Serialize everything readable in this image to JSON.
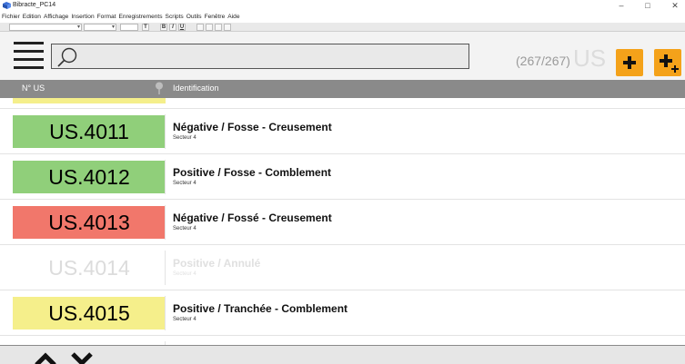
{
  "window": {
    "title": "Bibracte_PC14",
    "controls": [
      "–",
      "□",
      "✕"
    ]
  },
  "menu": [
    "Fichier",
    "Edition",
    "Affichage",
    "Insertion",
    "Format",
    "Enregistrements",
    "Scripts",
    "Outils",
    "Fenêtre",
    "Aide"
  ],
  "format_toolbar": {
    "buttons": [
      "T",
      "B",
      "I",
      "U"
    ]
  },
  "search": {
    "value": "",
    "placeholder": ""
  },
  "counter": {
    "text": "(267/267)",
    "unit": "US"
  },
  "columns": {
    "us": "N° US",
    "identification": "Identification"
  },
  "colors": {
    "green": "#90cf7a",
    "red": "#f1776b",
    "yellow": "#f5ef8b",
    "orange": "#f4a21a",
    "header_gray": "#8a8a8a"
  },
  "rows": [
    {
      "us": "US.4011",
      "title": "Négative / Fosse - Creusement",
      "sector": "Secteur 4",
      "color": "#90cf7a",
      "annulled": false
    },
    {
      "us": "US.4012",
      "title": "Positive / Fosse - Comblement",
      "sector": "Secteur 4",
      "color": "#90cf7a",
      "annulled": false
    },
    {
      "us": "US.4013",
      "title": "Négative / Fossé - Creusement",
      "sector": "Secteur 4",
      "color": "#f1776b",
      "annulled": false
    },
    {
      "us": "US.4014",
      "title": "Positive / Annulé",
      "sector": "Secteur 4",
      "color": "#ffffff",
      "annulled": true
    },
    {
      "us": "US.4015",
      "title": "Positive / Tranchée - Comblement",
      "sector": "Secteur 4",
      "color": "#f5ef8b",
      "annulled": false
    }
  ],
  "icons": {
    "menu": "hamburger-icon",
    "search": "search-icon",
    "add": "plus-icon",
    "add_multi": "plus-multi-icon",
    "pin": "pin-icon",
    "up": "chevron-up-icon",
    "down": "chevron-down-icon"
  }
}
